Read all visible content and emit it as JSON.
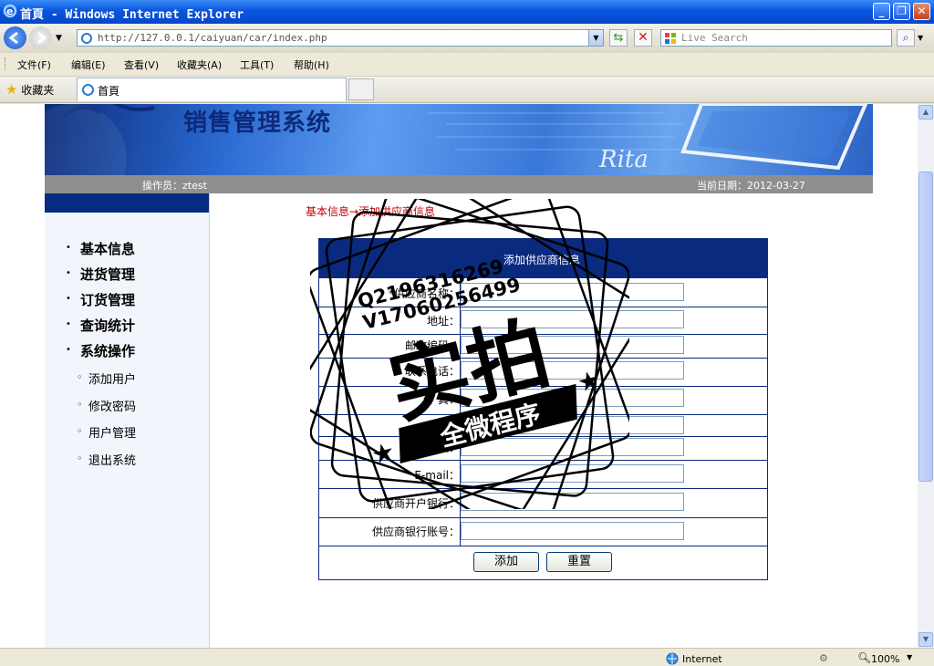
{
  "window": {
    "title": "首頁 - Windows Internet Explorer"
  },
  "address": {
    "url": "http://127.0.0.1/caiyuan/car/index.php"
  },
  "search": {
    "placeholder": "Live Search"
  },
  "menu": [
    "文件(F)",
    "编辑(E)",
    "查看(V)",
    "收藏夹(A)",
    "工具(T)",
    "帮助(H)"
  ],
  "favorites_label": "收藏夹",
  "tab": {
    "label": "首頁"
  },
  "banner": {
    "title": "销售管理系统",
    "signature": "Rita"
  },
  "infobar": {
    "operator": "操作员：ztest",
    "date": "当前日期：2012-03-27"
  },
  "sidebar": {
    "items": [
      "基本信息",
      "进货管理",
      "订货管理",
      "查询统计",
      "系统操作"
    ],
    "subitems": [
      "添加用户",
      "修改密码",
      "用户管理",
      "退出系统"
    ]
  },
  "breadcrumb": "基本信息→添加供应商信息",
  "form": {
    "title": "添加供应商信息",
    "fields": [
      {
        "label": "*供应商名称："
      },
      {
        "label": "地址："
      },
      {
        "label": "邮政编码："
      },
      {
        "label": "联系电话："
      },
      {
        "label": "传 真："
      },
      {
        "label": "简称："
      },
      {
        "label": "联系人："
      },
      {
        "label": "E-mail："
      },
      {
        "label": "供应商开户银行："
      },
      {
        "label": "供应商银行账号："
      }
    ],
    "submit_label": "添加",
    "reset_label": "重置"
  },
  "stamp": {
    "contact1": "Q2196316269",
    "contact2": "V17060256499",
    "main": "实拍",
    "sub": "全微程序"
  },
  "status": {
    "zone": "Internet",
    "zoom": "100%"
  }
}
